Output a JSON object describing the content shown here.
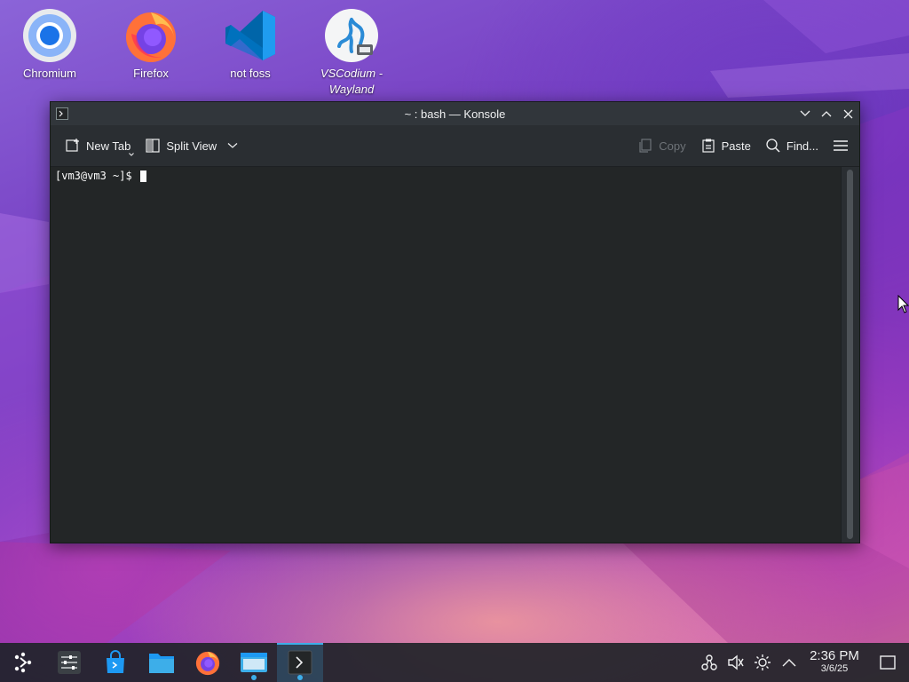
{
  "desktop": {
    "icons": [
      {
        "label": "Chromium",
        "icon": "chromium-icon"
      },
      {
        "label": "Firefox",
        "icon": "firefox-icon"
      },
      {
        "label": "not foss",
        "icon": "vscode-icon"
      },
      {
        "label": "VSCodium - Wayland",
        "icon": "vscodium-icon"
      }
    ]
  },
  "window": {
    "title": "~ : bash — Konsole",
    "app_icon": "konsole-icon",
    "controls": [
      "minimize",
      "maximize",
      "close"
    ]
  },
  "toolbar": {
    "new_tab": "New Tab",
    "split_view": "Split View",
    "copy": "Copy",
    "paste": "Paste",
    "find": "Find...",
    "menu_icon": "hamburger-menu-icon"
  },
  "terminal": {
    "prompt": "[vm3@vm3 ~]$ "
  },
  "taskbar": {
    "items": [
      {
        "name": "application-launcher",
        "icon": "kde-launcher-icon"
      },
      {
        "name": "system-settings",
        "icon": "settings-sliders-icon"
      },
      {
        "name": "discover",
        "icon": "store-bag-icon"
      },
      {
        "name": "dolphin",
        "icon": "folder-icon"
      },
      {
        "name": "firefox",
        "icon": "firefox-icon"
      },
      {
        "name": "file-manager-window",
        "icon": "window-icon"
      },
      {
        "name": "konsole",
        "icon": "terminal-icon",
        "active": true
      }
    ],
    "tray": [
      "network-icon",
      "volume-muted-icon",
      "brightness-icon",
      "expand-tray-icon"
    ],
    "clock": {
      "time": "2:36 PM",
      "date": "3/6/25"
    },
    "show_desktop_icon": "show-desktop-icon"
  },
  "colors": {
    "accent": "#3daee9",
    "terminal_bg": "#232627",
    "window_bg": "#2a2e32",
    "titlebar_bg": "#31363b"
  }
}
